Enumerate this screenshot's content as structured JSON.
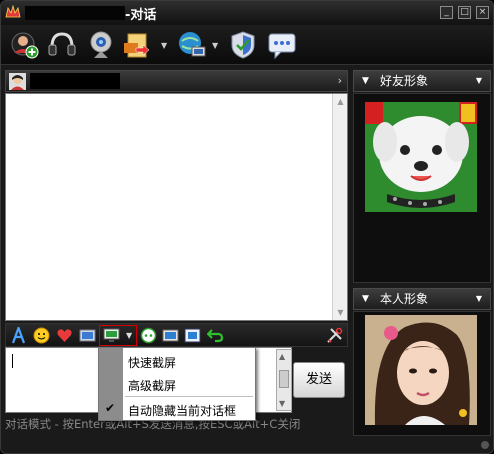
{
  "window": {
    "title": "-对话"
  },
  "toolbar": {
    "buttons": [
      {
        "name": "add-contact-icon"
      },
      {
        "name": "voice-headset-icon"
      },
      {
        "name": "webcam-icon"
      },
      {
        "name": "send-file-icon"
      },
      {
        "name": "remote-desktop-icon"
      },
      {
        "name": "security-shield-icon"
      },
      {
        "name": "message-bubble-icon"
      }
    ]
  },
  "format_bar": {
    "icons": [
      "font-icon",
      "emoticon-icon",
      "heart-icon",
      "image-icon",
      "screenshot-icon",
      "voice-message-icon",
      "picture-icon",
      "card-icon",
      "undo-arrow-icon",
      "settings-tools-icon"
    ]
  },
  "send": {
    "label": "发送"
  },
  "status": {
    "text": "对话模式 - 按Enter或Alt+S发送消息,按ESC或Alt+C关闭"
  },
  "screenshot_menu": {
    "items": [
      {
        "label": "快速截屏",
        "checked": false
      },
      {
        "label": "高级截屏",
        "checked": false
      },
      {
        "label": "自动隐藏当前对话框",
        "checked": true
      }
    ]
  },
  "side": {
    "friend_header": "好友形象",
    "self_header": "本人形象"
  },
  "colors": {
    "accent_red": "#d00000",
    "background": "#1a1a1a"
  }
}
